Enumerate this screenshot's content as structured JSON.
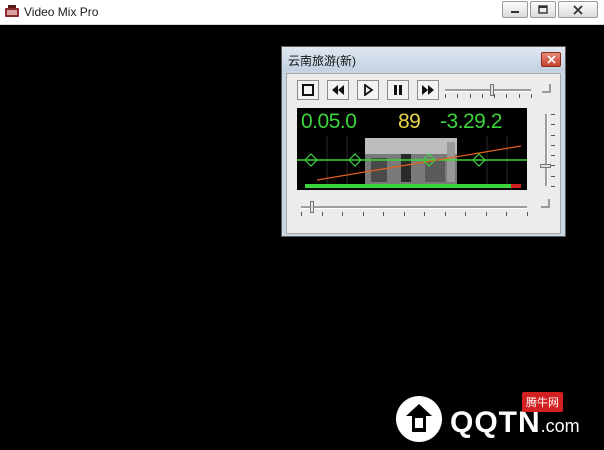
{
  "window": {
    "title": "Video Mix Pro",
    "icon": "app-icon"
  },
  "player": {
    "title": "云南旅游(新)",
    "controls": [
      "stop-icon",
      "rewind-icon",
      "play-icon",
      "pause-icon",
      "fast-forward-icon"
    ],
    "lcd": {
      "elapsed": "0.05.0",
      "counter": "89",
      "remaining": "-3.29.2",
      "elapsed_color": "#3cd43c",
      "counter_color": "#e8d44a",
      "remaining_color": "#3cd43c"
    },
    "volume_level": 0.55,
    "position_level": 0.05,
    "vertical_level": 0.72
  },
  "watermark": {
    "brand": "QQTN",
    "suffix": ".com",
    "badge": "腾牛网"
  },
  "colors": {
    "canvas": "#000000",
    "close_button": "#c6432e",
    "lcd_green": "#3cd43c"
  }
}
